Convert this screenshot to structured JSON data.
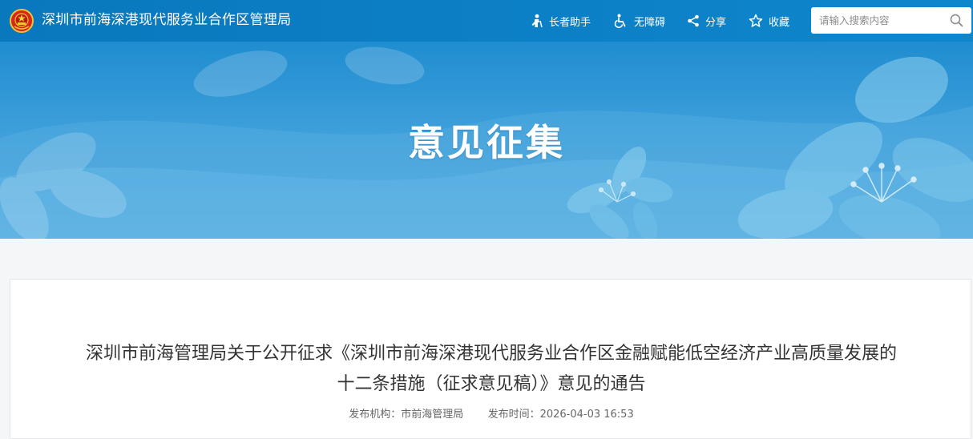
{
  "header": {
    "site_title": "深圳市前海深港现代服务业合作区管理局",
    "tools": {
      "elder": "长者助手",
      "accessibility": "无障碍",
      "share": "分享",
      "favorite": "收藏"
    },
    "search": {
      "placeholder": "请输入搜索内容",
      "icon": "search-icon"
    },
    "emblem_icon": "national-emblem-icon"
  },
  "banner": {
    "title": "意见征集"
  },
  "article": {
    "title": "深圳市前海管理局关于公开征求《深圳市前海深港现代服务业合作区金融赋能低空经济产业高质量发展的十二条措施（征求意见稿）》意见的通告",
    "publisher_label": "发布机构：",
    "publisher": "市前海管理局",
    "time_label": "发布时间：",
    "time": "2026-04-03 16:53"
  },
  "colors": {
    "header_bg": "#0c7fc5",
    "banner_bg": "#3d9fda",
    "text": "#333333"
  }
}
